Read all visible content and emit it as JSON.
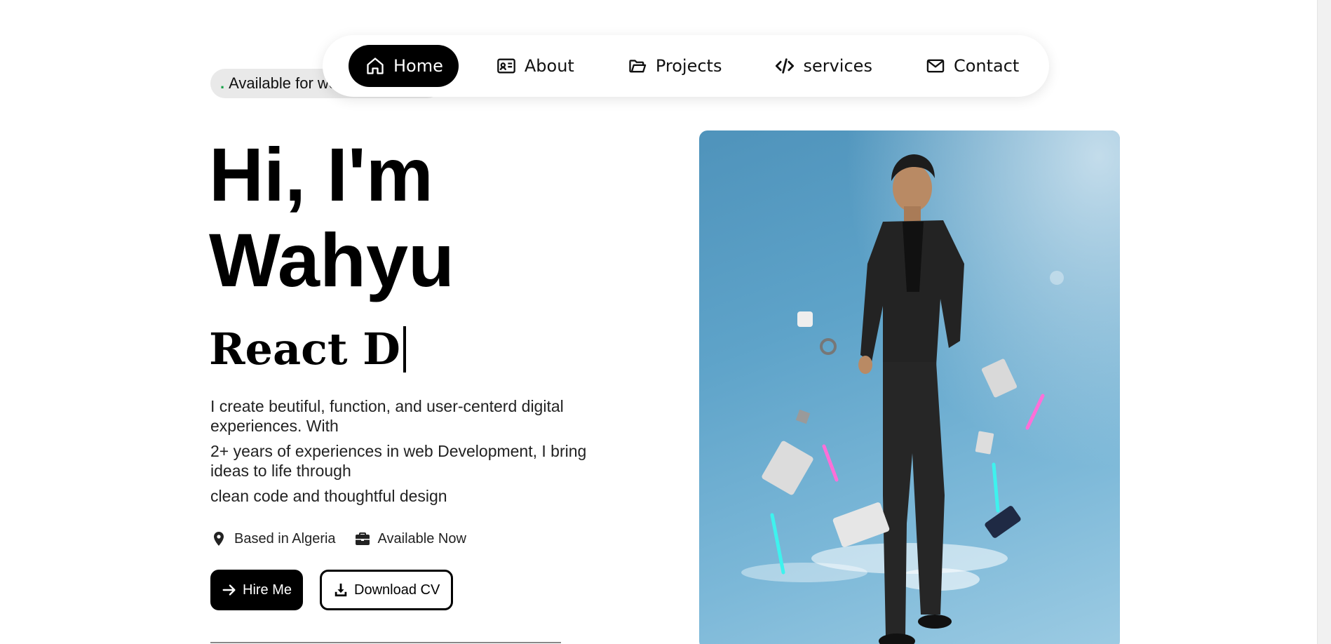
{
  "availability_badge": {
    "dot": ".",
    "text": "Available for work"
  },
  "nav": {
    "items": [
      {
        "label": "Home",
        "icon": "home-icon",
        "active": true
      },
      {
        "label": "About",
        "icon": "id-card-icon",
        "active": false
      },
      {
        "label": "Projects",
        "icon": "folder-icon",
        "active": false
      },
      {
        "label": "services",
        "icon": "code-icon",
        "active": false
      },
      {
        "label": "Contact",
        "icon": "envelope-icon",
        "active": false
      }
    ]
  },
  "hero": {
    "greeting_line1": "Hi, I'm",
    "greeting_line2": "Wahyu",
    "typed_role": "React D",
    "description": [
      "I create beutiful, function, and user-centerd digital experiences. With",
      "2+ years of experiences in web Development, I bring ideas to life through",
      "clean code and thoughtful design"
    ],
    "location": "Based in Algeria",
    "status": "Available Now",
    "hire_button": "Hire Me",
    "download_button": "Download CV"
  },
  "colors": {
    "accent": "#000000",
    "badge_dot": "#1aa34a",
    "badge_bg": "#e9e9e9",
    "photo_sky": "#5ea3c9"
  }
}
